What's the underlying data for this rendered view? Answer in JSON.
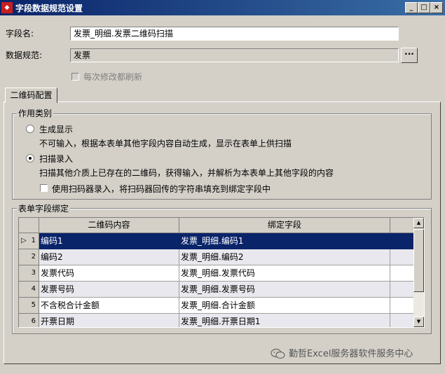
{
  "window": {
    "title": "字段数据规范设置",
    "app_icon": "app-logo",
    "buttons": {
      "minimize": "_",
      "maximize": "□",
      "close": "×"
    }
  },
  "form": {
    "field_name_label": "字段名:",
    "field_name_value": "发票_明细.发票二维码扫描",
    "data_spec_label": "数据规范:",
    "data_spec_value": "发票",
    "browse_label": "···",
    "refresh_each_edit_label": "每次修改都刷新"
  },
  "tab": {
    "label": "二维码配置"
  },
  "usage": {
    "legend": "作用类别",
    "option_generate": {
      "label": "生成显示",
      "desc": "不可输入，根据本表单其他字段内容自动生成，显示在表单上供扫描",
      "checked": false
    },
    "option_scan": {
      "label": "扫描录入",
      "desc": "扫描其他介质上已存在的二维码，获得输入，并解析为本表单上其他字段的内容",
      "checked": true
    },
    "use_scanner_label": "使用扫码器录入，将扫码器回传的字符串填充到绑定字段中"
  },
  "binding": {
    "legend": "表单字段绑定",
    "columns": [
      "二维码内容",
      "绑定字段"
    ],
    "rows": [
      {
        "num": "1",
        "content": "编码1",
        "field": "发票_明细.编码1"
      },
      {
        "num": "2",
        "content": "编码2",
        "field": "发票_明细.编码2"
      },
      {
        "num": "3",
        "content": "发票代码",
        "field": "发票_明细.发票代码"
      },
      {
        "num": "4",
        "content": "发票号码",
        "field": "发票_明细.发票号码"
      },
      {
        "num": "5",
        "content": "不含税合计金额",
        "field": "发票_明细.合计金额"
      },
      {
        "num": "6",
        "content": "开票日期",
        "field": "发票_明细.开票日期1"
      }
    ]
  },
  "watermark": {
    "text": "勤哲Excel服务器软件服务中心",
    "icon": "wechat-icon"
  },
  "colors": {
    "titlebar": "#0a246a",
    "selection": "#0a246a",
    "face": "#d4d0c8"
  }
}
